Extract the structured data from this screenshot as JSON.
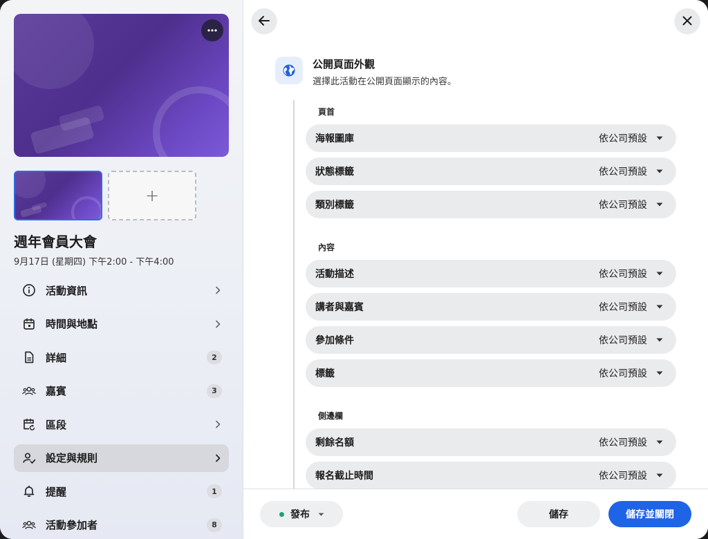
{
  "sidebar": {
    "event_title": "週年會員大會",
    "event_date": "9月17日 (星期四) 下午2:00 - 下午4:00",
    "add_thumb_label": "+",
    "items": [
      {
        "label": "活動資訊",
        "icon": "info-icon",
        "trail": "chevron"
      },
      {
        "label": "時間與地點",
        "icon": "calendar-icon",
        "trail": "chevron"
      },
      {
        "label": "詳細",
        "icon": "document-icon",
        "trail": "badge",
        "badge": "2"
      },
      {
        "label": "嘉賓",
        "icon": "people-icon",
        "trail": "badge",
        "badge": "3"
      },
      {
        "label": "區段",
        "icon": "calendar-repeat-icon",
        "trail": "chevron"
      },
      {
        "label": "設定與規則",
        "icon": "user-check-icon",
        "trail": "chevron",
        "active": true
      },
      {
        "label": "提醒",
        "icon": "bell-icon",
        "trail": "badge",
        "badge": "1"
      },
      {
        "label": "活動參加者",
        "icon": "people-icon",
        "trail": "badge",
        "badge": "8"
      }
    ]
  },
  "main": {
    "section_title": "公開頁面外觀",
    "section_desc": "選擇此活動在公開頁面顯示的內容。",
    "groups": [
      {
        "label": "頁首",
        "rows": [
          {
            "label": "海報圖庫",
            "value": "依公司預設"
          },
          {
            "label": "狀態標籤",
            "value": "依公司預設"
          },
          {
            "label": "類別標籤",
            "value": "依公司預設"
          }
        ]
      },
      {
        "label": "內容",
        "rows": [
          {
            "label": "活動描述",
            "value": "依公司預設"
          },
          {
            "label": "講者與嘉賓",
            "value": "依公司預設"
          },
          {
            "label": "參加條件",
            "value": "依公司預設"
          },
          {
            "label": "標籤",
            "value": "依公司預設"
          }
        ]
      },
      {
        "label": "側邊欄",
        "rows": [
          {
            "label": "剩餘名額",
            "value": "依公司預設"
          },
          {
            "label": "報名截止時間",
            "value": "依公司預設"
          }
        ]
      }
    ]
  },
  "footer": {
    "status_label": "發布",
    "save_label": "儲存",
    "save_close_label": "儲存並關閉"
  },
  "colors": {
    "accent": "#1f63e6",
    "status_published": "#1aa37a",
    "cover_purple": "#5b3a9a"
  }
}
